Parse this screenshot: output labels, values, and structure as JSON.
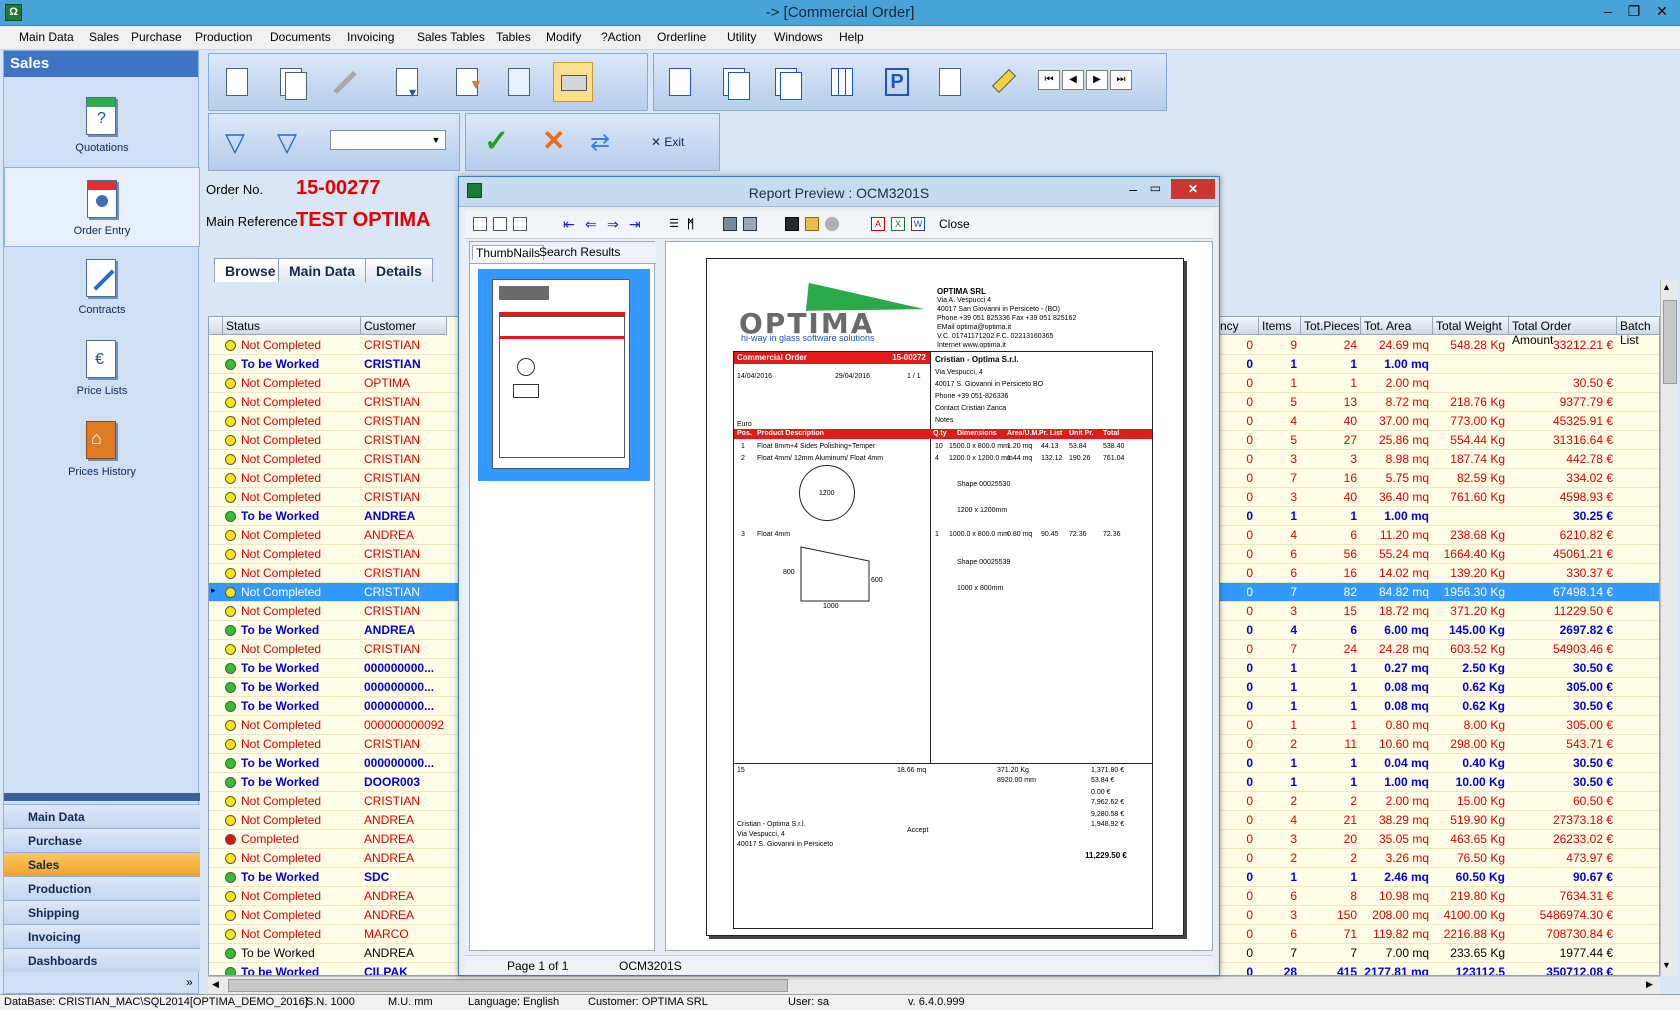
{
  "window": {
    "title": "-> [Commercial Order]"
  },
  "menu": [
    "Main Data",
    "Sales",
    "Purchase",
    "Production",
    "Documents",
    "Invoicing",
    "Sales Tables",
    "Tables",
    "Modify",
    "?Action",
    "Orderline",
    "Utility",
    "Windows",
    "Help"
  ],
  "sidebar": {
    "header": "Sales",
    "items": [
      {
        "label": "Quotations"
      },
      {
        "label": "Order Entry"
      },
      {
        "label": "Contracts"
      },
      {
        "label": "Price Lists"
      },
      {
        "label": "Prices History"
      }
    ],
    "nav": [
      {
        "label": "Main Data"
      },
      {
        "label": "Purchase"
      },
      {
        "label": "Sales"
      },
      {
        "label": "Production"
      },
      {
        "label": "Shipping"
      },
      {
        "label": "Invoicing"
      },
      {
        "label": "Dashboards"
      }
    ],
    "colors": {
      "active_nav": "#f2a32a",
      "header": "#3f74c5"
    }
  },
  "toolbar": {
    "exit_label": "Exit"
  },
  "order": {
    "number_label": "Order No.",
    "number": "15-00277",
    "reference_label": "Main Reference",
    "reference": "TEST OPTIMA"
  },
  "tabs": [
    {
      "label": "Browse"
    },
    {
      "label": "Main Data"
    },
    {
      "label": "Details"
    }
  ],
  "grid": {
    "headers_left": [
      "Status",
      "Customer"
    ],
    "headers_right": [
      "ncy",
      "Items",
      "Tot.Pieces",
      "Tot. Area",
      "Total Weight",
      "Total Order Amount",
      "Batch List"
    ],
    "rows": [
      {
        "status": "Not Completed",
        "customer": "CRISTIAN",
        "ncy": "0",
        "items": "9",
        "pieces": "24",
        "area": "24.69 mq",
        "weight": "548.28 Kg",
        "amount": "33212.21 €"
      },
      {
        "status": "To be Worked",
        "customer": "CRISTIAN",
        "ncy": "0",
        "items": "1",
        "pieces": "1",
        "area": "1.00 mq",
        "weight": "",
        "amount": ""
      },
      {
        "status": "Not Completed",
        "customer": "OPTIMA",
        "ncy": "0",
        "items": "1",
        "pieces": "1",
        "area": "2.00 mq",
        "weight": "",
        "amount": "30.50 €"
      },
      {
        "status": "Not Completed",
        "customer": "CRISTIAN",
        "ncy": "0",
        "items": "5",
        "pieces": "13",
        "area": "8.72 mq",
        "weight": "218.76 Kg",
        "amount": "9377.79 €"
      },
      {
        "status": "Not Completed",
        "customer": "CRISTIAN",
        "ncy": "0",
        "items": "4",
        "pieces": "40",
        "area": "37.00 mq",
        "weight": "773.00 Kg",
        "amount": "45325.91 €"
      },
      {
        "status": "Not Completed",
        "customer": "CRISTIAN",
        "ncy": "0",
        "items": "5",
        "pieces": "27",
        "area": "25.86 mq",
        "weight": "554.44 Kg",
        "amount": "31316.64 €"
      },
      {
        "status": "Not Completed",
        "customer": "CRISTIAN",
        "ncy": "0",
        "items": "3",
        "pieces": "3",
        "area": "8.98 mq",
        "weight": "187.74 Kg",
        "amount": "442.78 €"
      },
      {
        "status": "Not Completed",
        "customer": "CRISTIAN",
        "ncy": "0",
        "items": "7",
        "pieces": "16",
        "area": "5.75 mq",
        "weight": "82.59 Kg",
        "amount": "334.02 €"
      },
      {
        "status": "Not Completed",
        "customer": "CRISTIAN",
        "ncy": "0",
        "items": "3",
        "pieces": "40",
        "area": "36.40 mq",
        "weight": "761.60 Kg",
        "amount": "4598.93 €"
      },
      {
        "status": "To be Worked",
        "customer": "ANDREA",
        "ncy": "0",
        "items": "1",
        "pieces": "1",
        "area": "1.00 mq",
        "weight": "",
        "amount": "30.25 €"
      },
      {
        "status": "Not Completed",
        "customer": "ANDREA",
        "ncy": "0",
        "items": "4",
        "pieces": "6",
        "area": "11.20 mq",
        "weight": "238.68 Kg",
        "amount": "6210.82 €"
      },
      {
        "status": "Not Completed",
        "customer": "CRISTIAN",
        "ncy": "0",
        "items": "6",
        "pieces": "56",
        "area": "55.24 mq",
        "weight": "1664.40 Kg",
        "amount": "45061.21 €"
      },
      {
        "status": "Not Completed",
        "customer": "CRISTIAN",
        "ncy": "0",
        "items": "6",
        "pieces": "16",
        "area": "14.02 mq",
        "weight": "139.20 Kg",
        "amount": "330.37 €"
      },
      {
        "status": "Not Completed",
        "customer": "CRISTIAN",
        "ncy": "0",
        "items": "7",
        "pieces": "82",
        "area": "84.82 mq",
        "weight": "1956.30 Kg",
        "amount": "67498.14 €",
        "selected": true
      },
      {
        "status": "Not Completed",
        "customer": "CRISTIAN",
        "ncy": "0",
        "items": "3",
        "pieces": "15",
        "area": "18.72 mq",
        "weight": "371.20 Kg",
        "amount": "11229.50 €"
      },
      {
        "status": "To be Worked",
        "customer": "ANDREA",
        "ncy": "0",
        "items": "4",
        "pieces": "6",
        "area": "6.00 mq",
        "weight": "145.00 Kg",
        "amount": "2697.82 €"
      },
      {
        "status": "Not Completed",
        "customer": "CRISTIAN",
        "ncy": "0",
        "items": "7",
        "pieces": "24",
        "area": "24.28 mq",
        "weight": "603.52 Kg",
        "amount": "54903.46 €"
      },
      {
        "status": "To be Worked",
        "customer": "000000000...",
        "ncy": "0",
        "items": "1",
        "pieces": "1",
        "area": "0.27 mq",
        "weight": "2.50 Kg",
        "amount": "30.50 €"
      },
      {
        "status": "To be Worked",
        "customer": "000000000...",
        "ncy": "0",
        "items": "1",
        "pieces": "1",
        "area": "0.08 mq",
        "weight": "0.62 Kg",
        "amount": "305.00 €"
      },
      {
        "status": "To be Worked",
        "customer": "000000000...",
        "ncy": "0",
        "items": "1",
        "pieces": "1",
        "area": "0.08 mq",
        "weight": "0.62 Kg",
        "amount": "30.50 €"
      },
      {
        "status": "Not Completed",
        "customer": "000000000092",
        "ncy": "0",
        "items": "1",
        "pieces": "1",
        "area": "0.80 mq",
        "weight": "8.00 Kg",
        "amount": "305.00 €"
      },
      {
        "status": "Not Completed",
        "customer": "CRISTIAN",
        "ncy": "0",
        "items": "2",
        "pieces": "11",
        "area": "10.60 mq",
        "weight": "298.00 Kg",
        "amount": "543.71 €"
      },
      {
        "status": "To be Worked",
        "customer": "000000000...",
        "ncy": "0",
        "items": "1",
        "pieces": "1",
        "area": "0.04 mq",
        "weight": "0.40 Kg",
        "amount": "30.50 €"
      },
      {
        "status": "To be Worked",
        "customer": "DOOR003",
        "ncy": "0",
        "items": "1",
        "pieces": "1",
        "area": "1.00 mq",
        "weight": "10.00 Kg",
        "amount": "30.50 €"
      },
      {
        "status": "Not Completed",
        "customer": "CRISTIAN",
        "ncy": "0",
        "items": "2",
        "pieces": "2",
        "area": "2.00 mq",
        "weight": "15.00 Kg",
        "amount": "60.50 €"
      },
      {
        "status": "Not Completed",
        "customer": "ANDREA",
        "ncy": "0",
        "items": "4",
        "pieces": "21",
        "area": "38.29 mq",
        "weight": "519.90 Kg",
        "amount": "27373.18 €"
      },
      {
        "status": "Completed",
        "customer": "ANDREA",
        "ncy": "0",
        "items": "3",
        "pieces": "20",
        "area": "35.05 mq",
        "weight": "463.65 Kg",
        "amount": "26233.02 €"
      },
      {
        "status": "Not Completed",
        "customer": "ANDREA",
        "ncy": "0",
        "items": "2",
        "pieces": "2",
        "area": "3.26 mq",
        "weight": "76.50 Kg",
        "amount": "473.97 €"
      },
      {
        "status": "To be Worked",
        "customer": "SDC",
        "ncy": "0",
        "items": "1",
        "pieces": "1",
        "area": "2.46 mq",
        "weight": "60.50 Kg",
        "amount": "90.67 €"
      },
      {
        "status": "Not Completed",
        "customer": "ANDREA",
        "ncy": "0",
        "items": "6",
        "pieces": "8",
        "area": "10.98 mq",
        "weight": "219.80 Kg",
        "amount": "7634.31 €"
      },
      {
        "status": "Not Completed",
        "customer": "ANDREA",
        "ncy": "0",
        "items": "3",
        "pieces": "150",
        "area": "208.00 mq",
        "weight": "4100.00 Kg",
        "amount": "5486974.30 €"
      },
      {
        "status": "Not Completed",
        "customer": "MARCO",
        "ncy": "0",
        "items": "6",
        "pieces": "71",
        "area": "119.82 mq",
        "weight": "2216.88 Kg",
        "amount": "708730.84 €"
      },
      {
        "status": "To be Worked",
        "customer": "ANDREA",
        "ncy": "0",
        "items": "7",
        "pieces": "7",
        "area": "7.00 mq",
        "weight": "233.65 Kg",
        "amount": "1977.44 €",
        "plain": true
      },
      {
        "status": "To be Worked",
        "customer": "CILPAK",
        "ncy": "0",
        "items": "28",
        "pieces": "415",
        "area": "2177.81 mq",
        "weight": "123112.5",
        "amount": "350712.08 €"
      }
    ]
  },
  "preview": {
    "title": "Report Preview : OCM3201S",
    "close_label": "Close",
    "tabs": [
      "ThumbNails",
      "Search Results"
    ],
    "status_page": "Page 1 of 1",
    "status_report": "OCM3201S",
    "doc": {
      "brand": "OPTIMA",
      "slogan": "hi-way in glass software solutions",
      "company": "OPTIMA SRL",
      "company_lines": [
        "Via A. Vespucci 4",
        "40017 San Giovanni in Persiceto - (BO)",
        "Phone +39 051 825336     Fax  +39 051 825162",
        "EMail  optima@optima.it",
        "V.C.  01741171202        F.C.  02213160365",
        "Internet  www.optima.it"
      ],
      "title": "Commercial Order",
      "number": "15-00272",
      "entry_date": "14/04/2016",
      "delivery_date": "29/04/2016",
      "page": "1 / 1",
      "currency": "Euro",
      "customer": "Cristian - Optima S.r.l.",
      "customer_lines": [
        "Via Vespucci, 4",
        "40017 S. Giovanni in Persiceto BO",
        "Phone  +39 051-826336",
        "Contact  Cristian Zanca",
        "Notes"
      ],
      "columns": [
        "Pos.",
        "Product Description",
        "Q.ty",
        "Dimensions",
        "Area/U.M.",
        "Pr. List",
        "Unit Pr.",
        "Total"
      ],
      "lines": [
        {
          "pos": "1",
          "desc": "Float 8mm+4 Sides Polishing+Temper",
          "qty": "10",
          "dim": "1500.0 x 800.0 mm",
          "area": "1.20 mq",
          "list": "44.13",
          "unit": "53.84",
          "total": "538.40"
        },
        {
          "pos": "2",
          "desc": "Float 4mm/ 12mm Aluminum/ Float 4mm",
          "qty": "4",
          "dim": "1200.0 x 1200.0 mm",
          "area": "1.44 mq",
          "list": "132.12",
          "unit": "190.26",
          "total": "761.04"
        },
        {
          "pos": "3",
          "desc": "Float 4mm",
          "qty": "1",
          "dim": "1000.0 x 800.0 mm",
          "area": "0.80 mq",
          "list": "90.45",
          "unit": "72.36",
          "total": "72.36"
        }
      ],
      "shape1": "Shape 00025530",
      "shape1_dim": "1200 x 1200mm",
      "shape2": "Shape 00025539",
      "shape2_dim": "1000 x 800mm",
      "circle_label": "1200",
      "trap_labels": [
        "800",
        "600",
        "1000"
      ],
      "totals": {
        "pieces": "15",
        "area": "18.66 mq",
        "weight": "371.20 Kg",
        "length": "8920.00 mm",
        "subtotal": "1,371.80 €",
        "discount": "53.84 €",
        "costs": "0.00 €",
        "taxes": "7,962.62 €",
        "net_price": "9,280.58 €",
        "vat": "1,948.92 €",
        "total": "11,229.50 €"
      },
      "ship_to": [
        "Cristian - Optima S.r.l.",
        "Via Vespucci, 4",
        "40017 S. Giovanni in Persiceto"
      ],
      "accept": "Accept"
    }
  },
  "status": {
    "db": "DataBase: CRISTIAN_MAC\\SQL2014[OPTIMA_DEMO_2016]",
    "sn": "S.N. 1000",
    "mu": "M.U. mm",
    "language": "Language: English",
    "customer": "Customer: OPTIMA SRL",
    "user": "User: sa",
    "version": "v. 6.4.0.999"
  }
}
